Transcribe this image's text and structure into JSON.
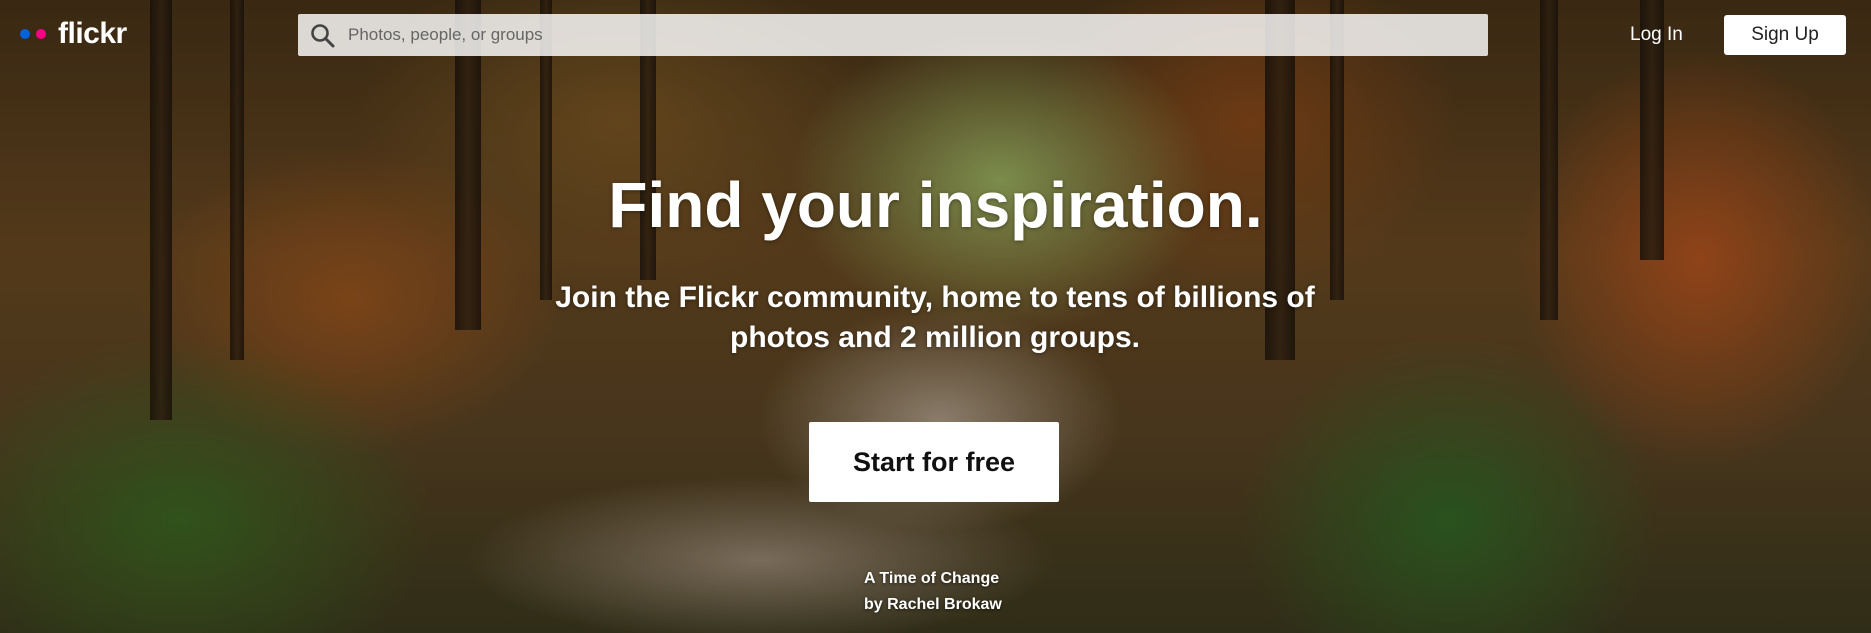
{
  "brand": {
    "name": "flickr",
    "dot_colors": [
      "#0063dc",
      "#ff0084"
    ]
  },
  "search": {
    "placeholder": "Photos, people, or groups",
    "value": ""
  },
  "nav": {
    "login_label": "Log In",
    "signup_label": "Sign Up"
  },
  "hero": {
    "headline": "Find your inspiration.",
    "subheadline": "Join the Flickr community, home to tens of billions of photos and 2 million groups.",
    "cta_label": "Start for free"
  },
  "photo_credit": {
    "title": "A Time of Change",
    "author": "by Rachel Brokaw"
  }
}
